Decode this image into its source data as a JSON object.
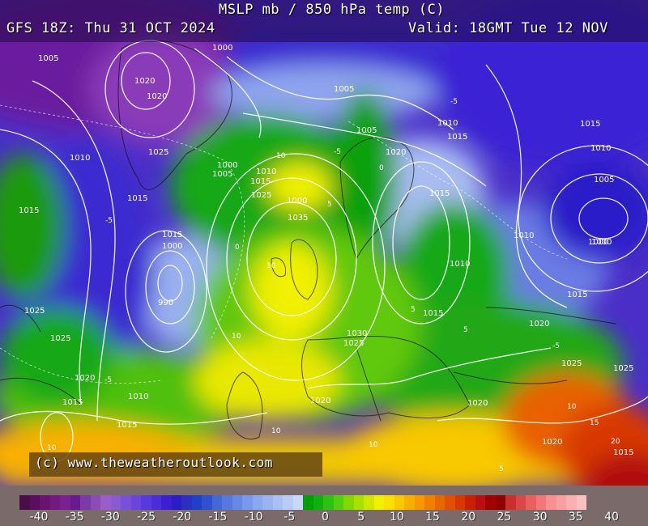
{
  "header": {
    "title": "MSLP mb / 850 hPa temp (C)",
    "model_run": "GFS 18Z: Thu 31 OCT 2024",
    "valid": "Valid: 18GMT Tue 12 NOV"
  },
  "credit": "(c) www.theweatheroutlook.com",
  "colorbar": {
    "tick_labels": [
      "-40",
      "-35",
      "-30",
      "-25",
      "-20",
      "-15",
      "-10",
      "-5",
      "0",
      "5",
      "10",
      "15",
      "20",
      "25",
      "30",
      "35",
      "40"
    ],
    "colors": [
      "#4a0d4a",
      "#5a0f5e",
      "#6a1470",
      "#731a80",
      "#7a2090",
      "#6a1a8e",
      "#7a3aa8",
      "#8a4cb8",
      "#9a5ec8",
      "#8a5ad0",
      "#7a50d8",
      "#6a44dc",
      "#5a38e0",
      "#4a2cd8",
      "#3a20d0",
      "#2a1cc8",
      "#2a30c0",
      "#2040c8",
      "#3050d0",
      "#4468d8",
      "#5878e0",
      "#6888e8",
      "#7a98ec",
      "#8aa8f0",
      "#9ab4f2",
      "#aac0f4",
      "#b8ccf6",
      "#c8d8f8",
      "#00a000",
      "#10b010",
      "#30c010",
      "#50d010",
      "#80d800",
      "#a8e000",
      "#d0e800",
      "#f0f000",
      "#f8e000",
      "#f8c800",
      "#f8b000",
      "#f89800",
      "#f08000",
      "#e86800",
      "#e05000",
      "#d83800",
      "#c82000",
      "#b81010",
      "#a00000",
      "#900000",
      "#c83030",
      "#d84848",
      "#e86060",
      "#f07878",
      "#f89090",
      "#f8a0a0",
      "#f8b0b0",
      "#f8c0c0"
    ]
  },
  "isobar_labels": [
    "1005",
    "1000",
    "1020",
    "1020",
    "1025",
    "1010",
    "1015",
    "1015",
    "1000",
    "1005",
    "1010",
    "1015",
    "1015",
    "1000",
    "1005",
    "1010",
    "1015",
    "1020",
    "1025",
    "1000",
    "1035",
    "1005",
    "1000",
    "990",
    "1025",
    "1025",
    "1020",
    "1015",
    "1015",
    "1010",
    "1020",
    "1030",
    "1025",
    "1020",
    "1015",
    "1010",
    "1015",
    "1000",
    "1005",
    "1010",
    "1010",
    "1015",
    "1020",
    "1025",
    "1025",
    "1020",
    "1015",
    "1015"
  ],
  "temp_labels": [
    "-5",
    "-5",
    "-5",
    "-5",
    "10",
    "5",
    "10",
    "0",
    "5",
    "10",
    "10",
    "10",
    "10",
    "5",
    "-5",
    "0",
    "5",
    "10",
    "15",
    "20"
  ]
}
